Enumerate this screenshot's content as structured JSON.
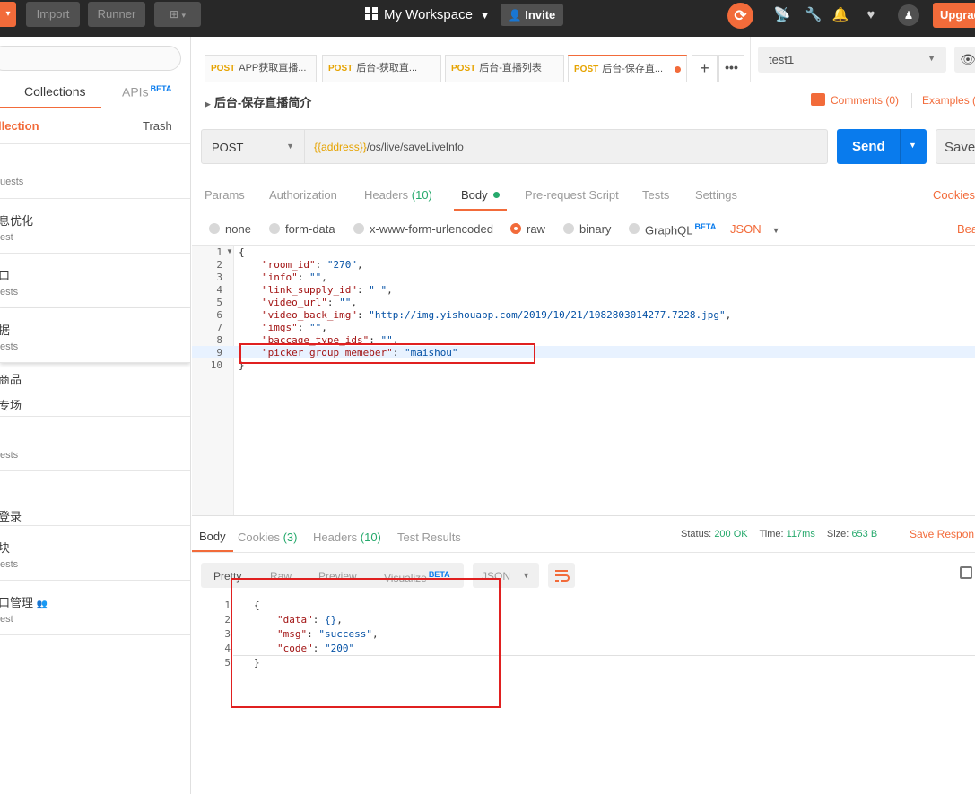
{
  "header": {
    "import": "Import",
    "runner": "Runner",
    "workspace": "My Workspace",
    "invite": "Invite",
    "upgrade": "Upgrade"
  },
  "sidebar": {
    "tab_collections": "Collections",
    "tab_apis": "APIs",
    "apis_badge": "BETA",
    "new_collection": "llection",
    "trash": "Trash",
    "items": [
      {
        "name": "",
        "sub": "uests"
      },
      {
        "name": "息优化",
        "sub": "est"
      },
      {
        "name": "口",
        "sub": "ests"
      },
      {
        "name": "据",
        "sub": "ests"
      },
      {
        "name": "商品",
        "sub": ""
      },
      {
        "name": "专场",
        "sub": ""
      },
      {
        "name": "",
        "sub": "ests"
      },
      {
        "name": "登录",
        "sub": ""
      },
      {
        "name": "块",
        "sub": "ests"
      },
      {
        "name": "口管理",
        "sub": "est"
      }
    ]
  },
  "tabs": [
    {
      "method": "POST",
      "label": "APP获取直播..."
    },
    {
      "method": "POST",
      "label": "后台-获取直..."
    },
    {
      "method": "POST",
      "label": "后台-直播列表"
    },
    {
      "method": "POST",
      "label": "后台-保存直..."
    }
  ],
  "environment": "test1",
  "request": {
    "name": "后台-保存直播简介",
    "comments": "Comments (0)",
    "examples": "Examples (",
    "method": "POST",
    "url_var": "{{address}}",
    "url_path": "/os/live/saveLiveInfo",
    "send": "Send",
    "save": "Save"
  },
  "req_tabs": {
    "params": "Params",
    "authorization": "Authorization",
    "headers": "Headers",
    "headers_count": "(10)",
    "body": "Body",
    "prerequest": "Pre-request Script",
    "tests": "Tests",
    "settings": "Settings",
    "cookies": "Cookies"
  },
  "body_types": {
    "none": "none",
    "form_data": "form-data",
    "urlencoded": "x-www-form-urlencoded",
    "raw": "raw",
    "binary": "binary",
    "graphql": "GraphQL",
    "graphql_badge": "BETA",
    "format": "JSON",
    "beautify": "Bea"
  },
  "request_body": [
    {
      "n": "1",
      "k": "",
      "v": "",
      "t": "{"
    },
    {
      "n": "2",
      "k": "\"room_id\"",
      "v": "\"270\"",
      "t": ","
    },
    {
      "n": "3",
      "k": "\"info\"",
      "v": "\"\"",
      "t": ","
    },
    {
      "n": "4",
      "k": "\"link_supply_id\"",
      "v": "\" \"",
      "t": ","
    },
    {
      "n": "5",
      "k": "\"video_url\"",
      "v": "\"\"",
      "t": ","
    },
    {
      "n": "6",
      "k": "\"video_back_img\"",
      "v": "\"http://img.yishouapp.com/2019/10/21/1082803014277.7228.jpg\"",
      "t": ","
    },
    {
      "n": "7",
      "k": "\"imgs\"",
      "v": "\"\"",
      "t": ","
    },
    {
      "n": "8",
      "k": "\"baccage_type_ids\"",
      "v": "\"\"",
      "t": ","
    },
    {
      "n": "9",
      "k": "\"picker_group_memeber\"",
      "v": "\"maishou\"",
      "t": ""
    },
    {
      "n": "10",
      "k": "",
      "v": "",
      "t": "}"
    }
  ],
  "response": {
    "tab_body": "Body",
    "tab_cookies": "Cookies",
    "cookies_count": "(3)",
    "tab_headers": "Headers",
    "headers_count": "(10)",
    "tab_tests": "Test Results",
    "status_label": "Status:",
    "status_value": "200 OK",
    "time_label": "Time:",
    "time_value": "117ms",
    "size_label": "Size:",
    "size_value": "653 B",
    "save": "Save Respon",
    "view_pretty": "Pretty",
    "view_raw": "Raw",
    "view_preview": "Preview",
    "view_visualize": "Visualize",
    "visualize_badge": "BETA",
    "format": "JSON",
    "lines": [
      {
        "n": "1",
        "k": "",
        "v": "",
        "t": "{"
      },
      {
        "n": "2",
        "k": "\"data\"",
        "v": "{}",
        "t": ","
      },
      {
        "n": "3",
        "k": "\"msg\"",
        "v": "\"success\"",
        "t": ","
      },
      {
        "n": "4",
        "k": "\"code\"",
        "v": "\"200\"",
        "t": ""
      },
      {
        "n": "5",
        "k": "",
        "v": "",
        "t": "}"
      }
    ]
  }
}
